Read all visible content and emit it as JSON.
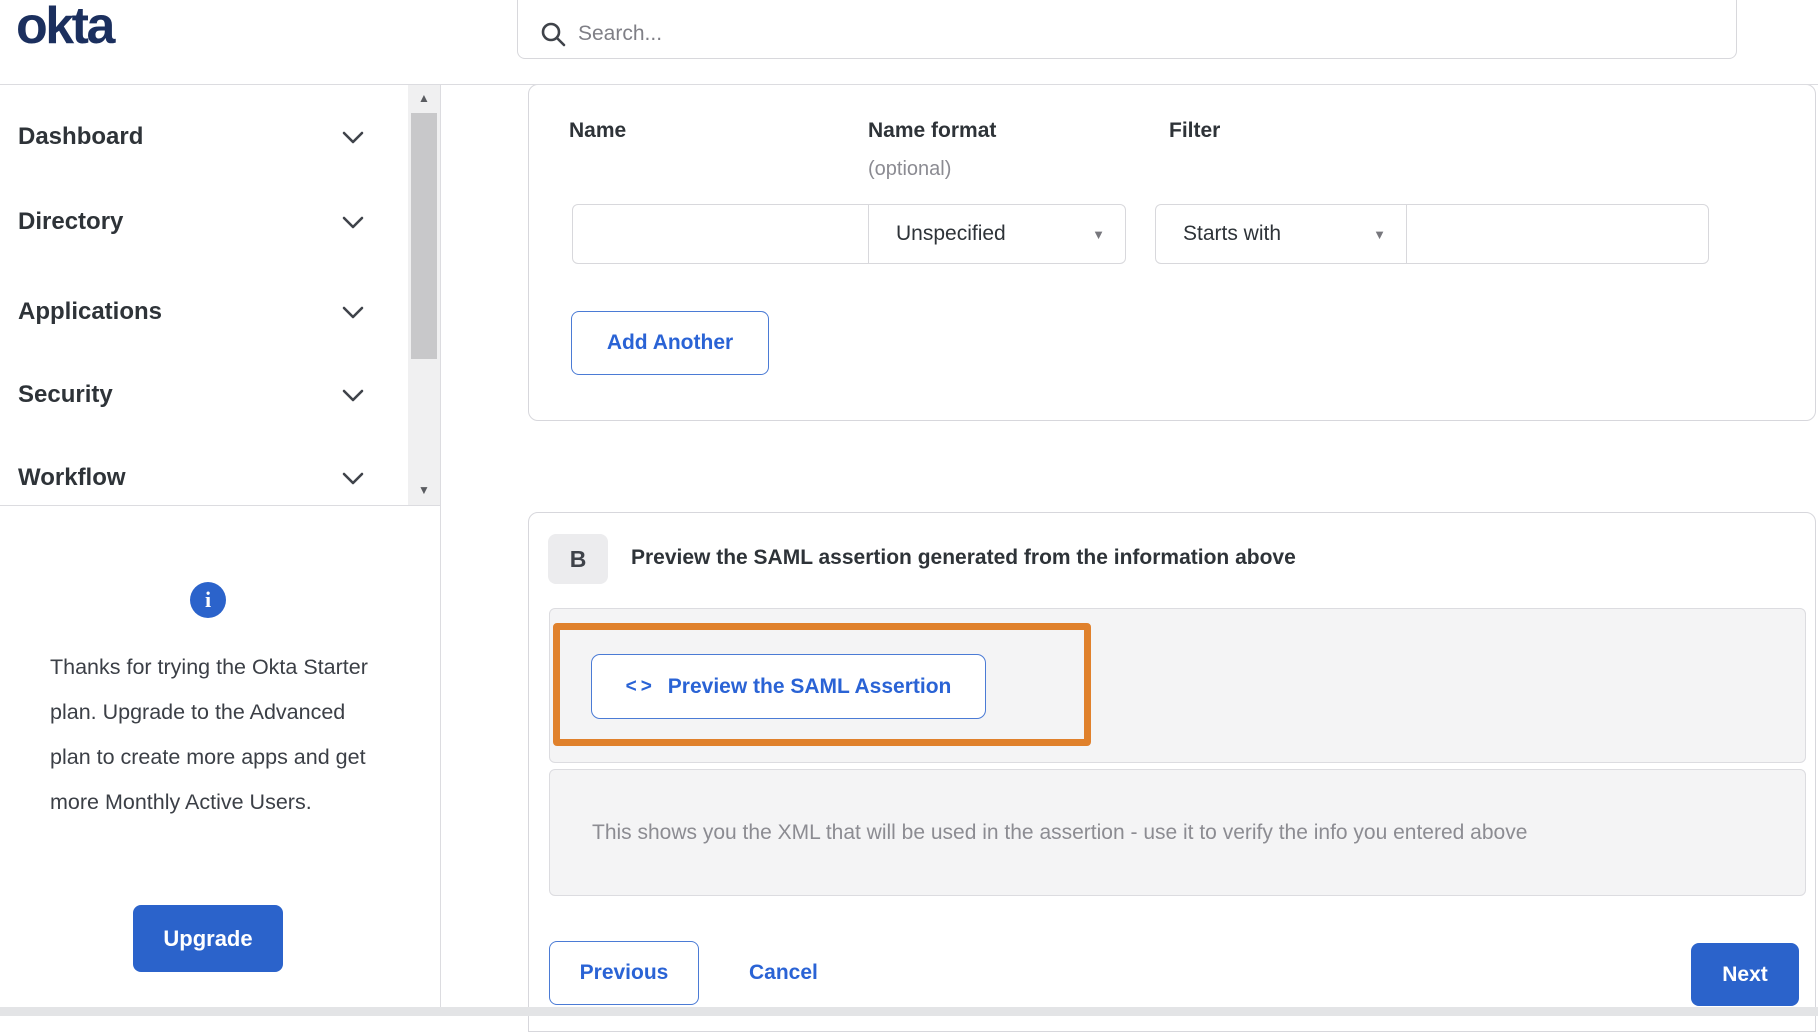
{
  "header": {
    "logo_text": "okta",
    "search": {
      "placeholder": "Search..."
    }
  },
  "sidebar": {
    "items": [
      {
        "label": "Dashboard"
      },
      {
        "label": "Directory"
      },
      {
        "label": "Applications"
      },
      {
        "label": "Security"
      },
      {
        "label": "Workflow"
      }
    ],
    "upgrade_panel": {
      "message": "Thanks for trying the Okta Starter plan. Upgrade to the Advanced plan to create more apps and get more Monthly Active Users.",
      "button_label": "Upgrade",
      "info_glyph": "i"
    }
  },
  "main": {
    "attribute_form": {
      "name_label": "Name",
      "name_format_label": "Name format",
      "name_format_hint": "(optional)",
      "filter_label": "Filter",
      "row": {
        "name_value": "",
        "name_format_selected": "Unspecified",
        "filter_type_selected": "Starts with",
        "filter_value": ""
      },
      "add_another_label": "Add Another",
      "caret_glyph": "▼"
    },
    "preview_section": {
      "step_badge": "B",
      "title": "Preview the SAML assertion generated from the information above",
      "preview_button_icon": "<>",
      "preview_button_label": "Preview the SAML Assertion",
      "description": "This shows you the XML that will be used in the assertion - use it to verify the info you entered above"
    },
    "footer": {
      "previous_label": "Previous",
      "cancel_label": "Cancel",
      "next_label": "Next"
    }
  },
  "scrollbar": {
    "up_glyph": "▲",
    "down_glyph": "▼"
  },
  "colors": {
    "accent_blue": "#2b63cb",
    "link_blue": "#2a63d5",
    "logo_navy": "#1b2f5e",
    "highlight_orange": "#e0812c",
    "border_gray": "#d7d7dc",
    "box_gray": "#f4f4f5"
  }
}
